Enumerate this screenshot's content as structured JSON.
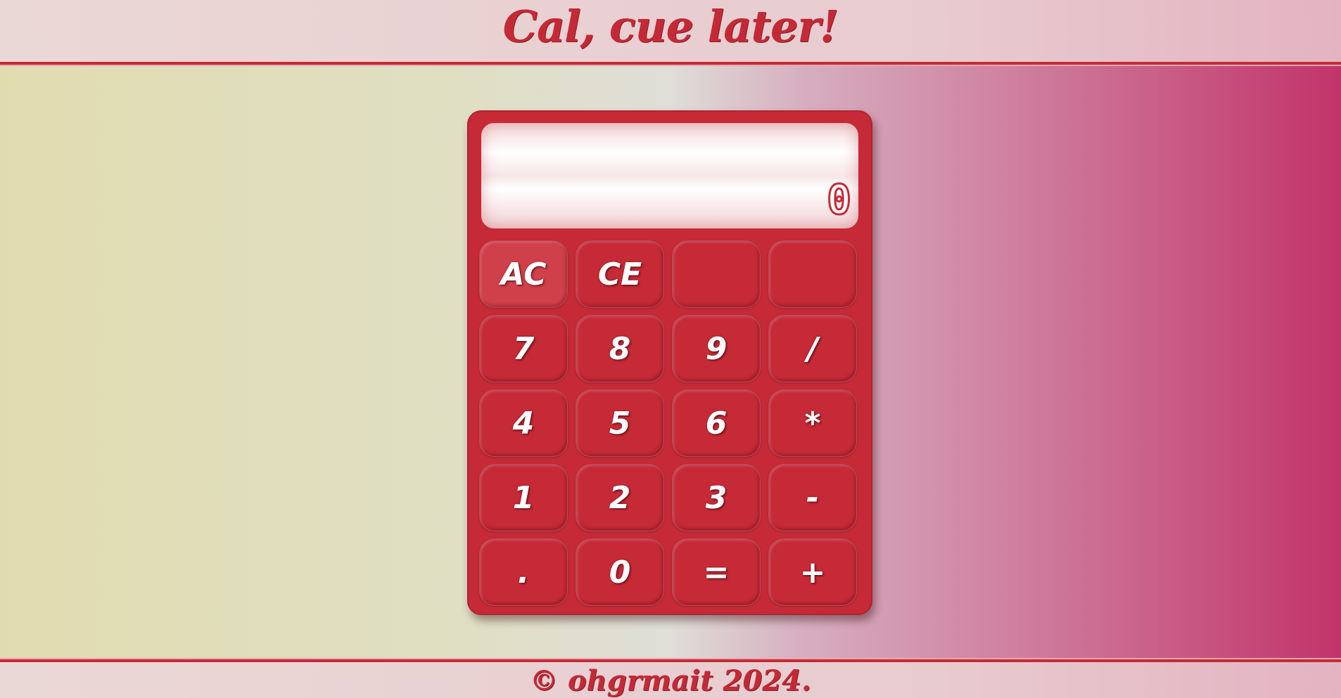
{
  "header": {
    "title": "Cal, cue later!"
  },
  "calculator": {
    "display_value": "0",
    "keys": [
      {
        "id": "ac",
        "label": "AC"
      },
      {
        "id": "ce",
        "label": "CE"
      },
      {
        "id": "blank-1",
        "label": ""
      },
      {
        "id": "blank-2",
        "label": ""
      },
      {
        "id": "seven",
        "label": "7"
      },
      {
        "id": "eight",
        "label": "8"
      },
      {
        "id": "nine",
        "label": "9"
      },
      {
        "id": "divide",
        "label": "/"
      },
      {
        "id": "four",
        "label": "4"
      },
      {
        "id": "five",
        "label": "5"
      },
      {
        "id": "six",
        "label": "6"
      },
      {
        "id": "multiply",
        "label": "*"
      },
      {
        "id": "one",
        "label": "1"
      },
      {
        "id": "two",
        "label": "2"
      },
      {
        "id": "three",
        "label": "3"
      },
      {
        "id": "subtract",
        "label": "-"
      },
      {
        "id": "decimal",
        "label": "."
      },
      {
        "id": "zero",
        "label": "0"
      },
      {
        "id": "equals",
        "label": "="
      },
      {
        "id": "add",
        "label": "+"
      }
    ]
  },
  "footer": {
    "copyright": "© ohgrmait 2024."
  },
  "colors": {
    "accent": "#c52a36",
    "header_bg": "#ead8d6",
    "display_bg": "#ffffff"
  }
}
